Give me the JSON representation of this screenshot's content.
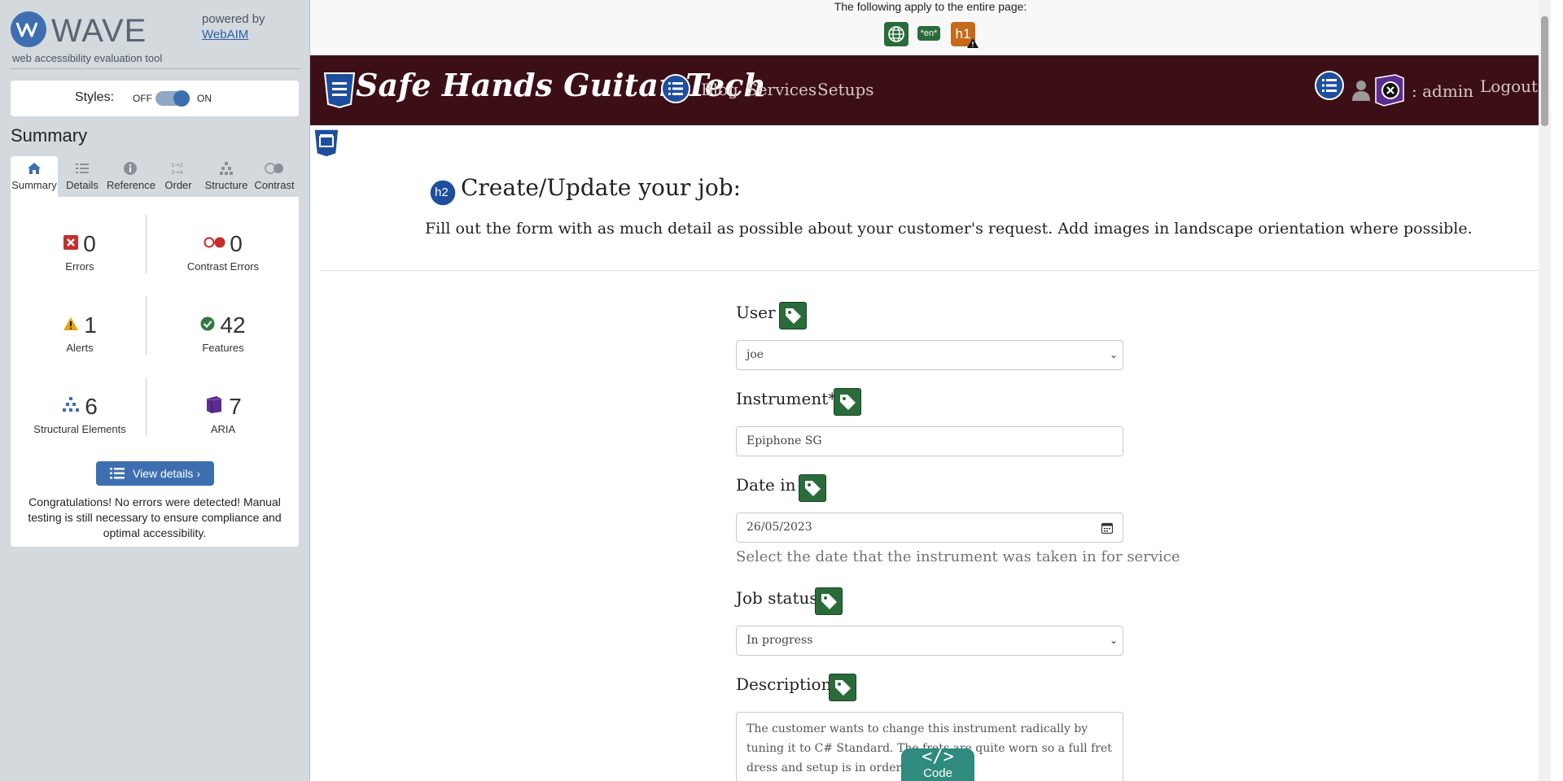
{
  "wave": {
    "title": "WAVE",
    "tagline": "web accessibility evaluation tool",
    "powered_by": "powered by",
    "webaim": "WebAIM",
    "styles_label": "Styles:",
    "styles_off": "OFF",
    "styles_on": "ON",
    "summary_heading": "Summary",
    "tabs": [
      {
        "label": "Summary",
        "icon": "home-icon"
      },
      {
        "label": "Details",
        "icon": "list-icon"
      },
      {
        "label": "Reference",
        "icon": "info-icon"
      },
      {
        "label": "Order",
        "icon": "order-icon"
      },
      {
        "label": "Structure",
        "icon": "structure-icon"
      },
      {
        "label": "Contrast",
        "icon": "contrast-icon"
      }
    ],
    "stats": {
      "errors": {
        "count": "0",
        "label": "Errors"
      },
      "contrast_errors": {
        "count": "0",
        "label": "Contrast Errors"
      },
      "alerts": {
        "count": "1",
        "label": "Alerts"
      },
      "features": {
        "count": "42",
        "label": "Features"
      },
      "structural": {
        "count": "6",
        "label": "Structural Elements"
      },
      "aria": {
        "count": "7",
        "label": "ARIA"
      }
    },
    "view_details": "View details ›",
    "congrats": "Congratulations! No errors were detected! Manual testing is still necessary to ensure compliance and optimal accessibility."
  },
  "page": {
    "apply_text": "The following apply to the entire page:",
    "lang_badge": "*en*",
    "h1_badge": "h1",
    "h2_badge": "h2",
    "brand": "Safe Hands Guitar Tech",
    "nav": [
      "Blog",
      "Services",
      "Setups"
    ],
    "user": ": admin",
    "logout": "Logout",
    "heading": "Create/Update your job:",
    "intro": "Fill out the form with as much detail as possible about your customer's request. Add images in landscape orientation where possible.",
    "form": {
      "user_label": "User",
      "user_value": "joe",
      "instrument_label": "Instrument*",
      "instrument_value": "Epiphone SG",
      "date_label": "Date in",
      "date_value": "26/05/2023",
      "date_help": "Select the date that the instrument was taken in for service",
      "status_label": "Job status",
      "status_value": "In progress",
      "description_label": "Description",
      "description_value": "The customer wants to change this instrument radically by tuning it to C# Standard. The frets are quite worn so a full fret dress and setup is in order."
    },
    "code_tab": "Code"
  },
  "colors": {
    "navbar": "#3c0f17",
    "wave_blue": "#3d6fb0",
    "tag_green": "#2a6b3a"
  }
}
